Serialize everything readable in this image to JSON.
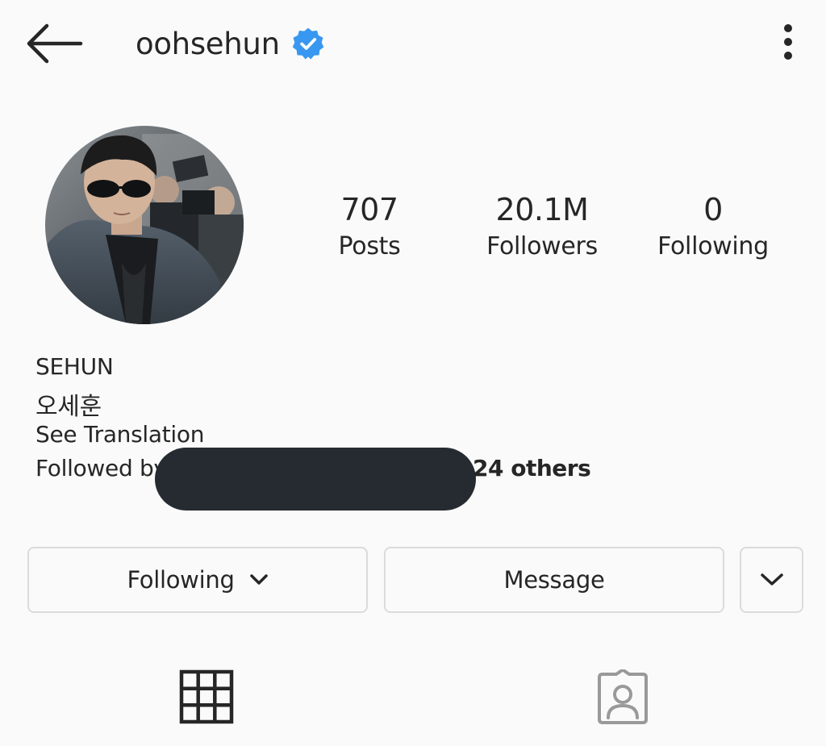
{
  "header": {
    "username": "oohsehun",
    "back_icon": "arrow-left-icon",
    "verified_icon": "verified-badge-icon",
    "more_icon": "more-vertical-icon"
  },
  "profile": {
    "avatar": "profile-photo"
  },
  "stats": {
    "posts": {
      "value": "707",
      "label": "Posts"
    },
    "followers": {
      "value": "20.1M",
      "label": "Followers"
    },
    "following": {
      "value": "0",
      "label": "Following"
    }
  },
  "bio": {
    "name": "SEHUN",
    "korean_name": "오세훈",
    "see_translation": "See Translation",
    "followed_by_prefix": "Followed by",
    "followed_by_suffix": "24 others"
  },
  "actions": {
    "following_label": "Following",
    "message_label": "Message",
    "following_chevron_icon": "chevron-down-icon",
    "more_chevron_icon": "chevron-down-icon"
  },
  "tabs": {
    "grid_icon": "grid-icon",
    "tagged_icon": "tagged-user-icon"
  },
  "colors": {
    "background": "#fafafa",
    "text": "#262626",
    "verified_blue": "#3897f0",
    "border": "#dbdbdb",
    "redaction": "#252b31"
  }
}
